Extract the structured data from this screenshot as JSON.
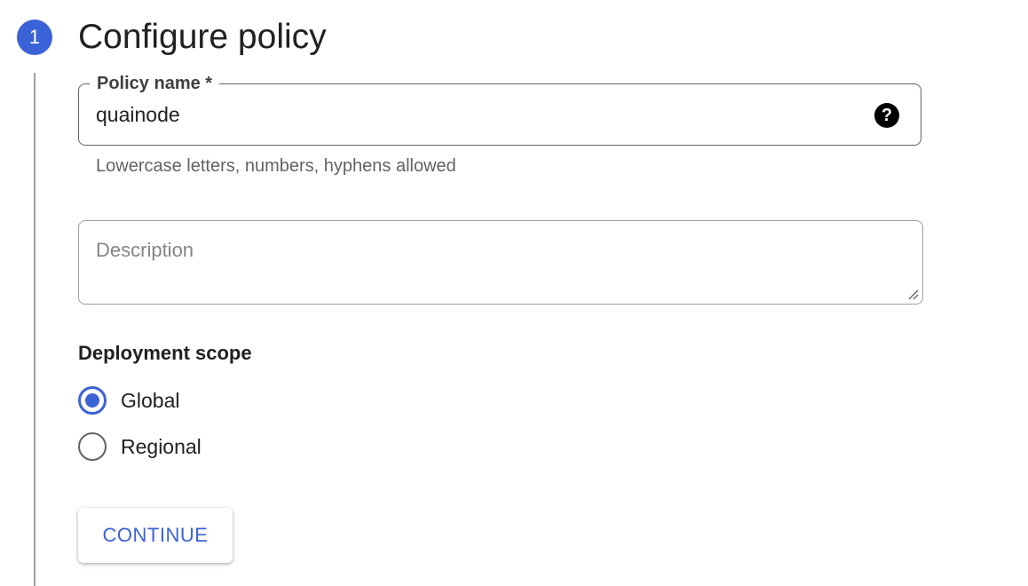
{
  "step": {
    "number": "1",
    "title": "Configure policy",
    "badge_color": "#3b62d6"
  },
  "policy_name": {
    "label": "Policy name *",
    "value": "quainode",
    "help_icon": "help-circle-icon",
    "hint": "Lowercase letters, numbers, hyphens allowed"
  },
  "description": {
    "placeholder": "Description",
    "value": ""
  },
  "deployment_scope": {
    "label": "Deployment scope",
    "options": [
      {
        "label": "Global",
        "selected": true
      },
      {
        "label": "Regional",
        "selected": false
      }
    ]
  },
  "actions": {
    "continue_label": "CONTINUE",
    "accent_color": "#3b62d6"
  }
}
